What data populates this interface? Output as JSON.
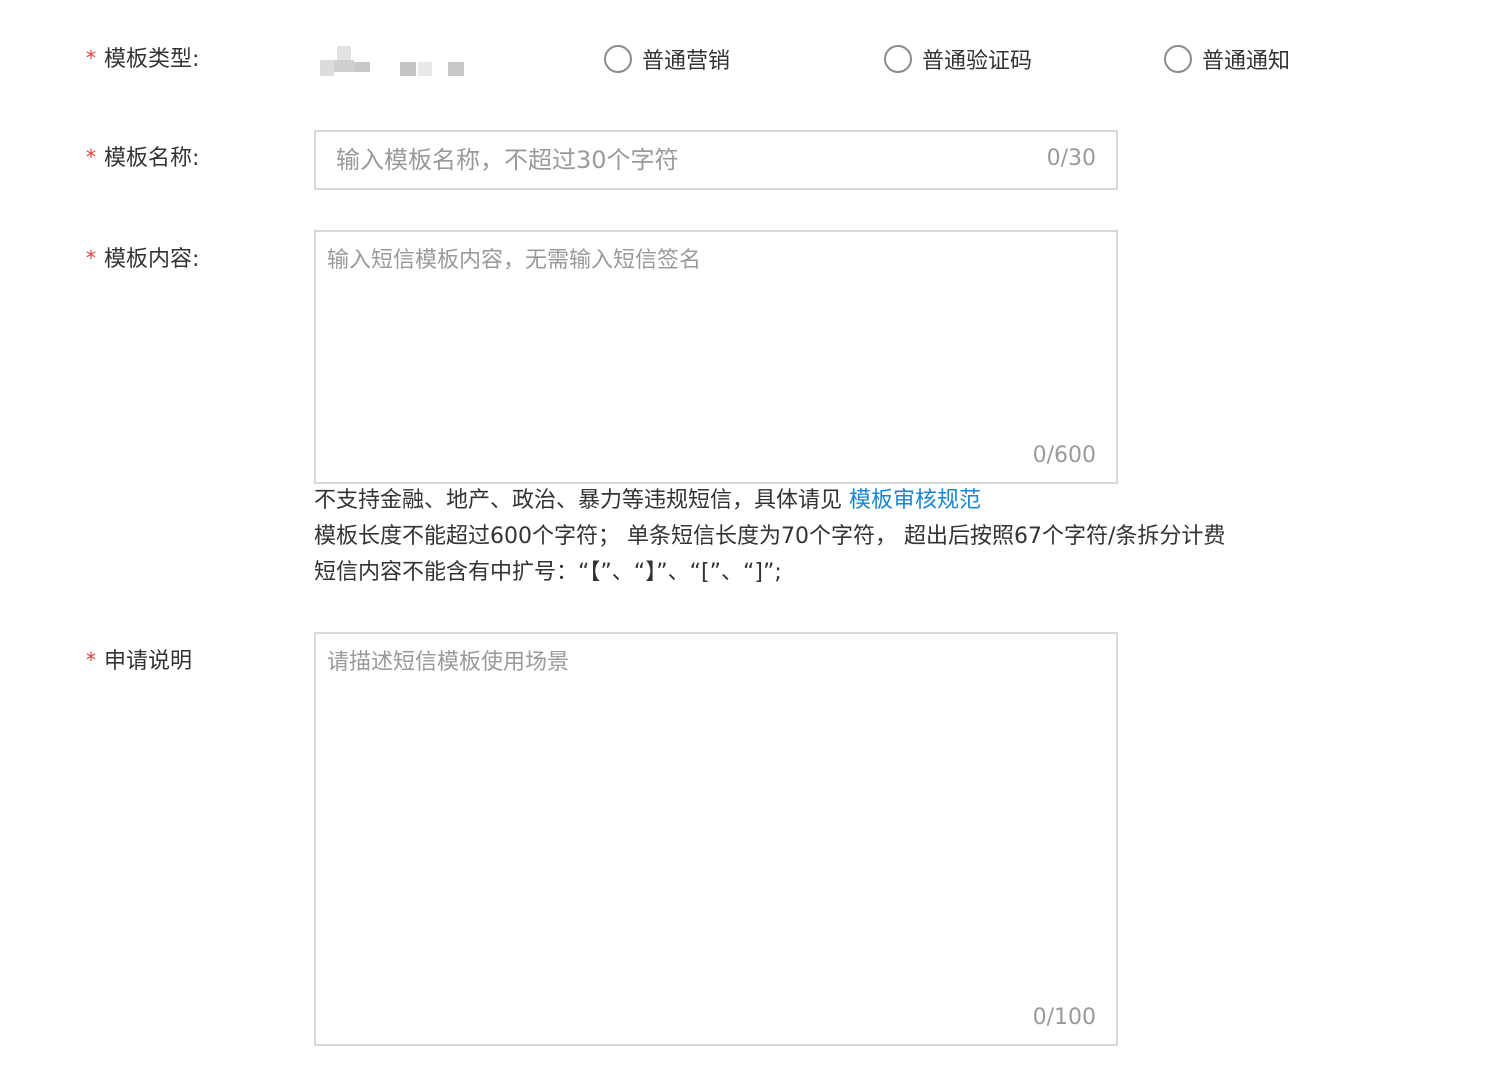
{
  "form": {
    "required_mark": "*",
    "template_type": {
      "label": "模板类型:",
      "options": [
        {
          "label": "普通营销"
        },
        {
          "label": "普通验证码"
        },
        {
          "label": "普通通知"
        }
      ]
    },
    "template_name": {
      "label": "模板名称:",
      "value": "",
      "placeholder": "输入模板名称，不超过30个字符",
      "counter": "0/30"
    },
    "template_content": {
      "label": "模板内容:",
      "value": "",
      "placeholder": "输入短信模板内容，无需输入短信签名",
      "counter": "0/600",
      "hints": {
        "line1_prefix": "不支持金融、地产、政治、暴力等违规短信，具体请见 ",
        "line1_link": "模板审核规范",
        "line2": "模板长度不能超过600个字符； 单条短信长度为70个字符， 超出后按照67个字符/条拆分计费",
        "line3": "短信内容不能含有中扩号：“【”、“】”、“[”、“]”;"
      }
    },
    "application_note": {
      "label": "申请说明",
      "value": "",
      "placeholder": "请描述短信模板使用场景",
      "counter": "0/100"
    }
  },
  "colors": {
    "required": "#e83a3a",
    "link": "#1a86d4",
    "border": "#d9d9d9",
    "placeholder": "#9a9a9a"
  }
}
